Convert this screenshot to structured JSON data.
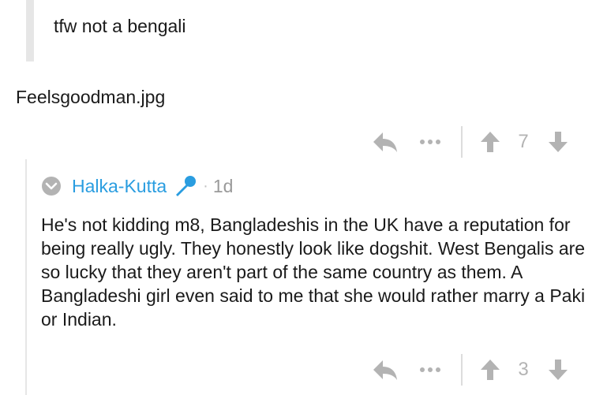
{
  "quote": {
    "text": "tfw not a bengali"
  },
  "comment": {
    "text": "Feelsgoodman.jpg",
    "score": "7"
  },
  "reply": {
    "username": "Halka-Kutta",
    "timestamp": "1d",
    "separator": "·",
    "text": "He's not kidding m8, Bangladeshis in the UK have a reputation for being really ugly. They honestly look like dogshit. West Bengalis are so lucky that they aren't part of the same country as them. A Bangladeshi girl even said to me that she would rather marry a Paki or Indian.",
    "score": "3"
  },
  "icons": {
    "reply": "reply-arrow-icon",
    "more": "more-dots-icon",
    "upvote": "upvote-arrow-icon",
    "downvote": "downvote-arrow-icon",
    "collapse": "collapse-chevron-icon",
    "flair": "microphone-icon"
  },
  "colors": {
    "icon_gray": "#b3b3b3",
    "username_blue": "#2a9de0",
    "quote_bar": "#e6e6e6",
    "text": "#1a1a1a"
  }
}
